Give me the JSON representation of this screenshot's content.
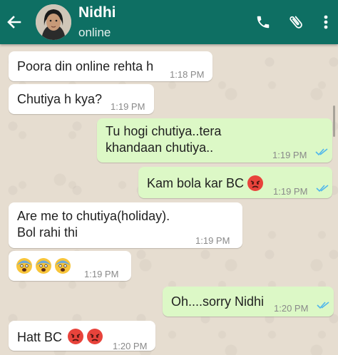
{
  "header": {
    "contact_name": "Nidhi",
    "status": "online",
    "color": "#0e6f63",
    "icons": [
      "back-arrow-icon",
      "phone-icon",
      "paperclip-icon",
      "more-vert-icon"
    ]
  },
  "messages": [
    {
      "dir": "in",
      "text": "Poora din online rehta h",
      "time": "1:18 PM"
    },
    {
      "dir": "in",
      "text": "Chutiya h kya?",
      "time": "1:19 PM"
    },
    {
      "dir": "out",
      "lines": [
        "Tu hogi chutiya..tera",
        "khandaan chutiya.."
      ],
      "time": "1:19 PM",
      "read": true
    },
    {
      "dir": "out",
      "text": "Kam bola kar BC",
      "emoji": [
        "angry-face"
      ],
      "time": "1:19 PM",
      "read": true
    },
    {
      "dir": "in",
      "lines": [
        "Are me to chutiya(holiday).",
        "Bol rahi thi"
      ],
      "time": "1:19 PM"
    },
    {
      "dir": "in",
      "emoji": [
        "fearful-face",
        "fearful-face",
        "fearful-face"
      ],
      "time": "1:19 PM"
    },
    {
      "dir": "out",
      "text": "Oh....sorry Nidhi",
      "time": "1:20 PM",
      "read": true
    },
    {
      "dir": "in",
      "text": "Hatt BC",
      "emoji": [
        "angry-face",
        "angry-face"
      ],
      "time": "1:20 PM"
    }
  ],
  "colors": {
    "incoming_bubble": "#ffffff",
    "outgoing_bubble": "#dcf8c6",
    "read_ticks": "#4fb6ec"
  }
}
